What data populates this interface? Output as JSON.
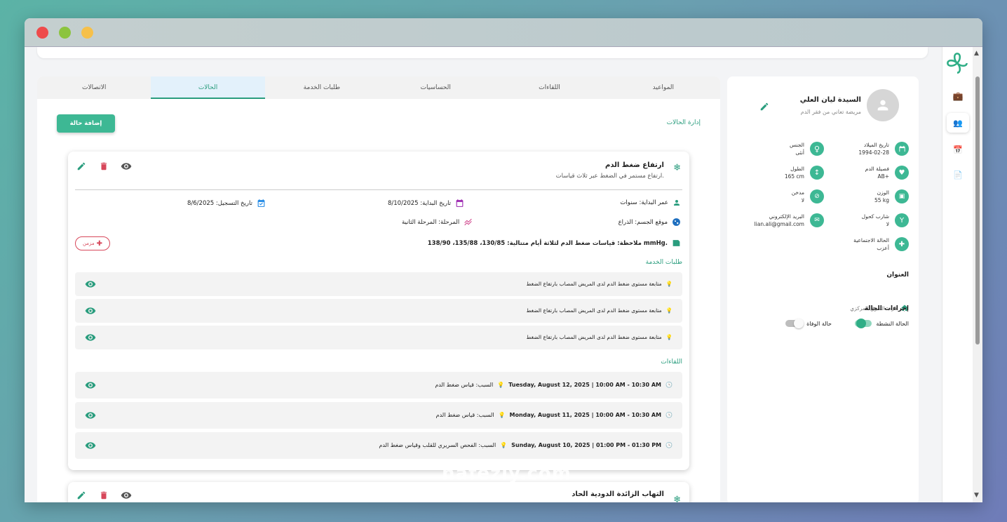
{
  "profile": {
    "name": "السيدة ليان العلي",
    "subtitle": "مريضة تعاني من فقر الدم",
    "fields": [
      {
        "label": "تاريخ الميلاد",
        "value": "1994-02-28"
      },
      {
        "label": "الجنس",
        "value": "أنثى"
      },
      {
        "label": "فصيلة الدم",
        "value": "AB+"
      },
      {
        "label": "الطول",
        "value": "165 cm"
      },
      {
        "label": "الوزن",
        "value": "55 kg"
      },
      {
        "label": "مدخن",
        "value": "لا"
      },
      {
        "label": "شارب كحول",
        "value": "لا"
      },
      {
        "label": "البريد الإلكتروني",
        "value": "lian.ali@gmail.com"
      },
      {
        "label": "الحالة الاجتماعية",
        "value": "أعزب"
      }
    ],
    "address_title": "العنوان",
    "address": "قرب السوق المركزي",
    "actions_title": "إجراءات الحالة",
    "active_label": "الحالة النشطة",
    "death_label": "حالة الوفاة"
  },
  "tabs": [
    "المواعيد",
    "اللقاءات",
    "الحساسيات",
    "طلبات الخدمة",
    "الحالات",
    "الاتصالات"
  ],
  "active_tab": "الحالات",
  "main": {
    "section_title": "إدارة الحالات",
    "add_button": "إضافة حالة"
  },
  "condition": {
    "title": "ارتفاع ضغط الدم",
    "description": "ارتفاع مستمر في الضغط عبر ثلاث قياسات.",
    "onset_age": "عمر البداية: سنوات",
    "start_date": "تاريخ البداية: 8/10/2025",
    "recorded_date": "تاريخ التسجيل: 8/6/2025",
    "body_site": "موقع الجسم: الذراع",
    "stage": "المرحلة: المرحلة الثانية",
    "note": "ملاحظة: قياسات ضغط الدم لثلاثة أيام متتالية: 130/85، 135/88، 138/90 mmHg.",
    "chip": "مزمن",
    "service_title": "طلبات الخدمة",
    "services": [
      "متابعة مستوى ضغط الدم لدى المريض المصاب بارتفاع الضغط",
      "متابعة مستوى ضغط الدم لدى المريض المصاب بارتفاع الضغط",
      "متابعة مستوى ضغط الدم لدى المريض المصاب بارتفاع الضغط"
    ],
    "encounters_title": "اللقاءات",
    "encounters": [
      {
        "time": "Tuesday, August 12, 2025 | 10:00 AM - 10:30 AM",
        "reason": "السبب: قياس ضغط الدم"
      },
      {
        "time": "Monday, August 11, 2025 | 10:00 AM - 10:30 AM",
        "reason": "السبب: قياس ضغط الدم"
      },
      {
        "time": "Sunday, August 10, 2025 | 01:00 PM - 01:30 PM",
        "reason": "السبب: الفحص السريري للقلب وقياس ضغط الدم"
      }
    ]
  },
  "condition2": {
    "title": "التهاب الزائدة الدودية الحاد"
  },
  "watermark": "nafezly.com",
  "colors": {
    "accent": "#2a9d7e",
    "button": "#3db894",
    "danger": "#d7475a"
  }
}
